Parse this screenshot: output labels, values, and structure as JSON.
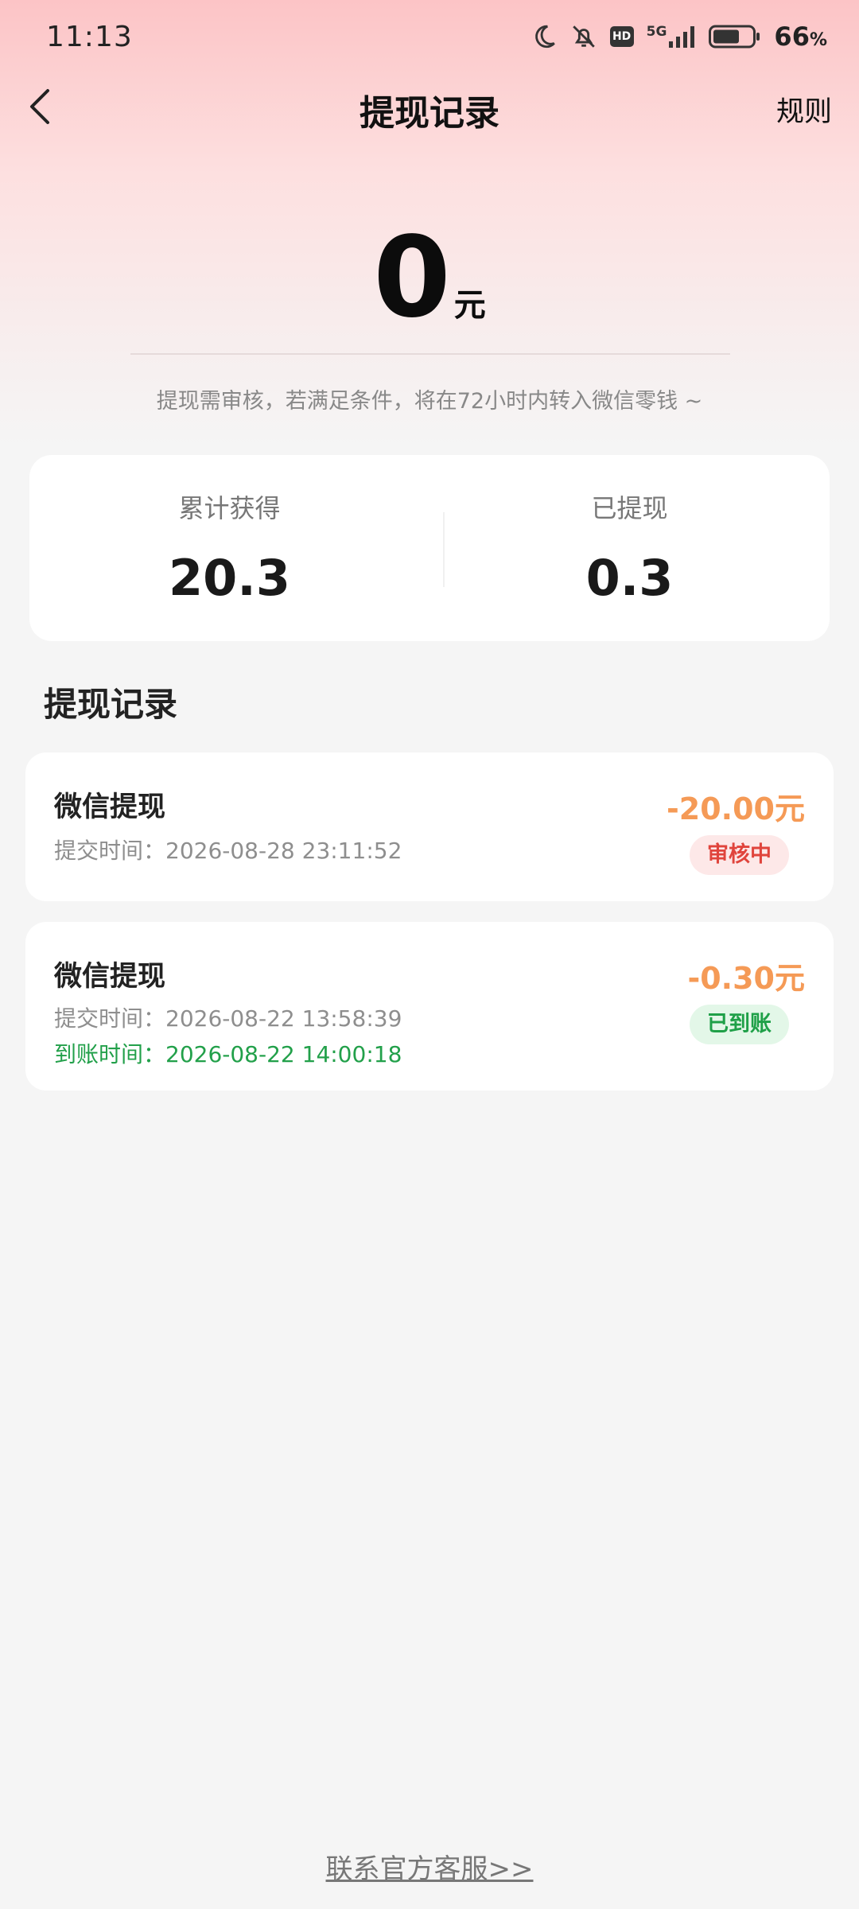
{
  "status_bar": {
    "time": "11:13",
    "network": "5G",
    "hd_label": "HD",
    "battery": "66",
    "battery_unit": "%"
  },
  "nav": {
    "title": "提现记录",
    "rules": "规则"
  },
  "balance": {
    "amount": "0",
    "unit": "元",
    "notice": "提现需审核，若满足条件，将在72小时内转入微信零钱 ~"
  },
  "stats": {
    "earned_label": "累计获得",
    "earned_value": "20.3",
    "withdrawn_label": "已提现",
    "withdrawn_value": "0.3"
  },
  "records_section": {
    "title": "提现记录"
  },
  "records": [
    {
      "title": "微信提现",
      "submit_time": "提交时间：2026-08-28 23:11:52",
      "amount": "-20.00元",
      "status": "审核中"
    },
    {
      "title": "微信提现",
      "submit_time": "提交时间：2026-08-22 13:58:39",
      "arrive_time": "到账时间：2026-08-22 14:00:18",
      "amount": "-0.30元",
      "status": "已到账"
    }
  ],
  "footer": {
    "contact": "联系官方客服>>"
  },
  "colors": {
    "amount": "#f59a56",
    "review_badge": "#e0443c",
    "done_badge": "#1fa048"
  }
}
